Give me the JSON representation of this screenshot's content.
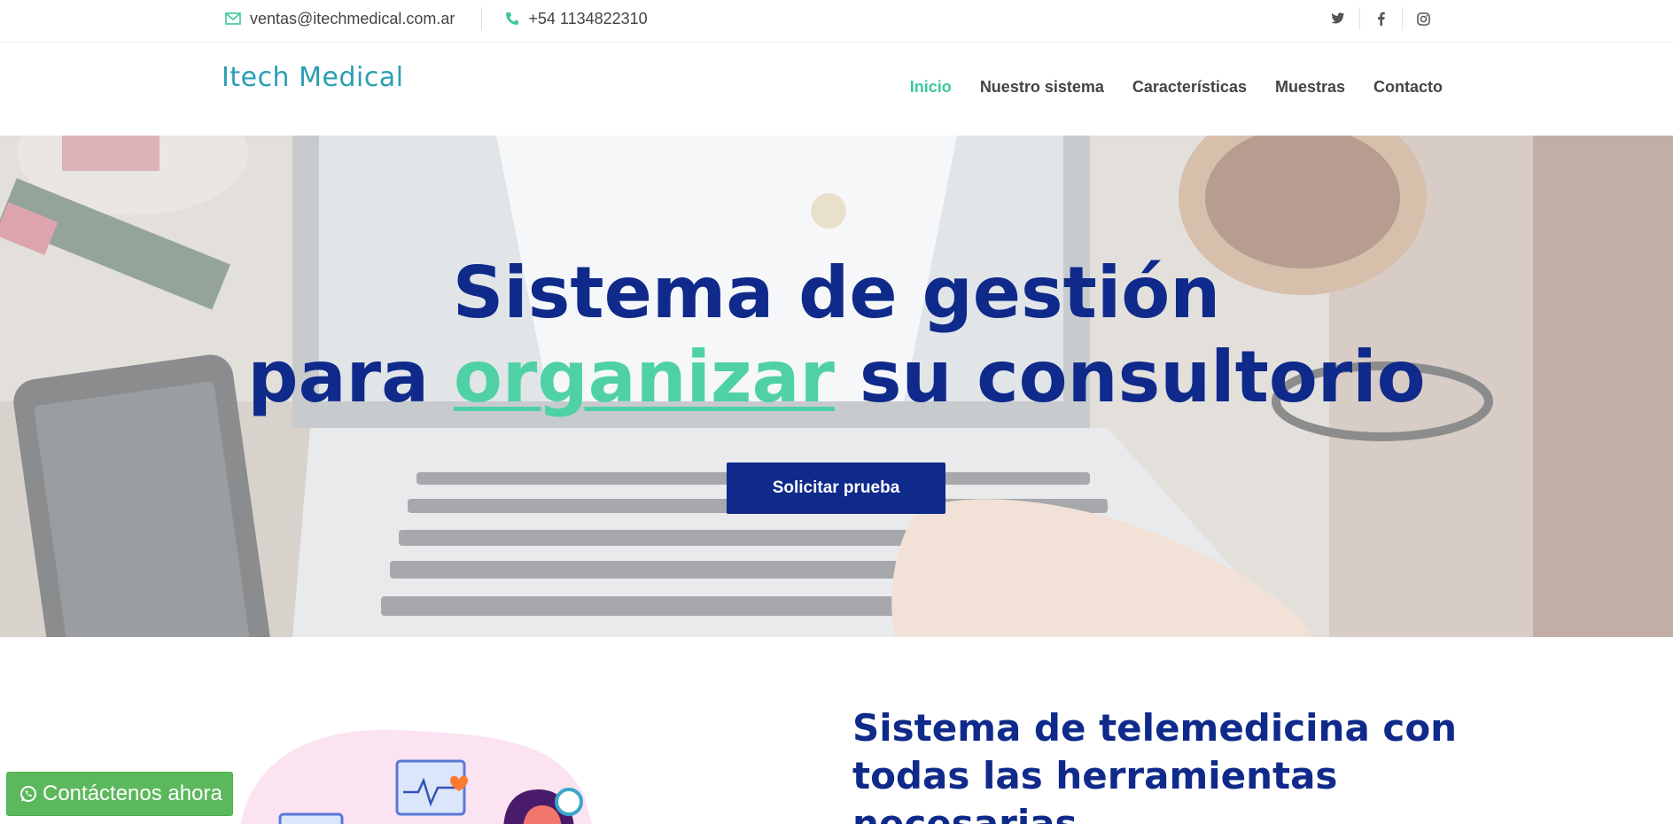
{
  "topbar": {
    "email": "ventas@itechmedical.com.ar",
    "phone": "+54 1134822310",
    "social": [
      "twitter-icon",
      "facebook-icon",
      "instagram-icon"
    ]
  },
  "header": {
    "logo": "Itech Medical",
    "nav": [
      {
        "label": "Inicio",
        "active": true
      },
      {
        "label": "Nuestro sistema",
        "active": false
      },
      {
        "label": "Características",
        "active": false
      },
      {
        "label": "Muestras",
        "active": false
      },
      {
        "label": "Contacto",
        "active": false
      }
    ]
  },
  "hero": {
    "line1": "Sistema de gestión",
    "line2_pre": "para ",
    "line2_highlight": "organizar",
    "line2_post": " su consultorio",
    "cta": "Solicitar prueba"
  },
  "section": {
    "heading": "Sistema de telemedicina con todas las herramientas necesarias"
  },
  "whatsapp": {
    "label": "Contáctenos ahora"
  },
  "colors": {
    "primary": "#0f2a8a",
    "accent": "#4fd1a5",
    "logo": "#2b9fb3",
    "whatsapp": "#5cb85c"
  }
}
